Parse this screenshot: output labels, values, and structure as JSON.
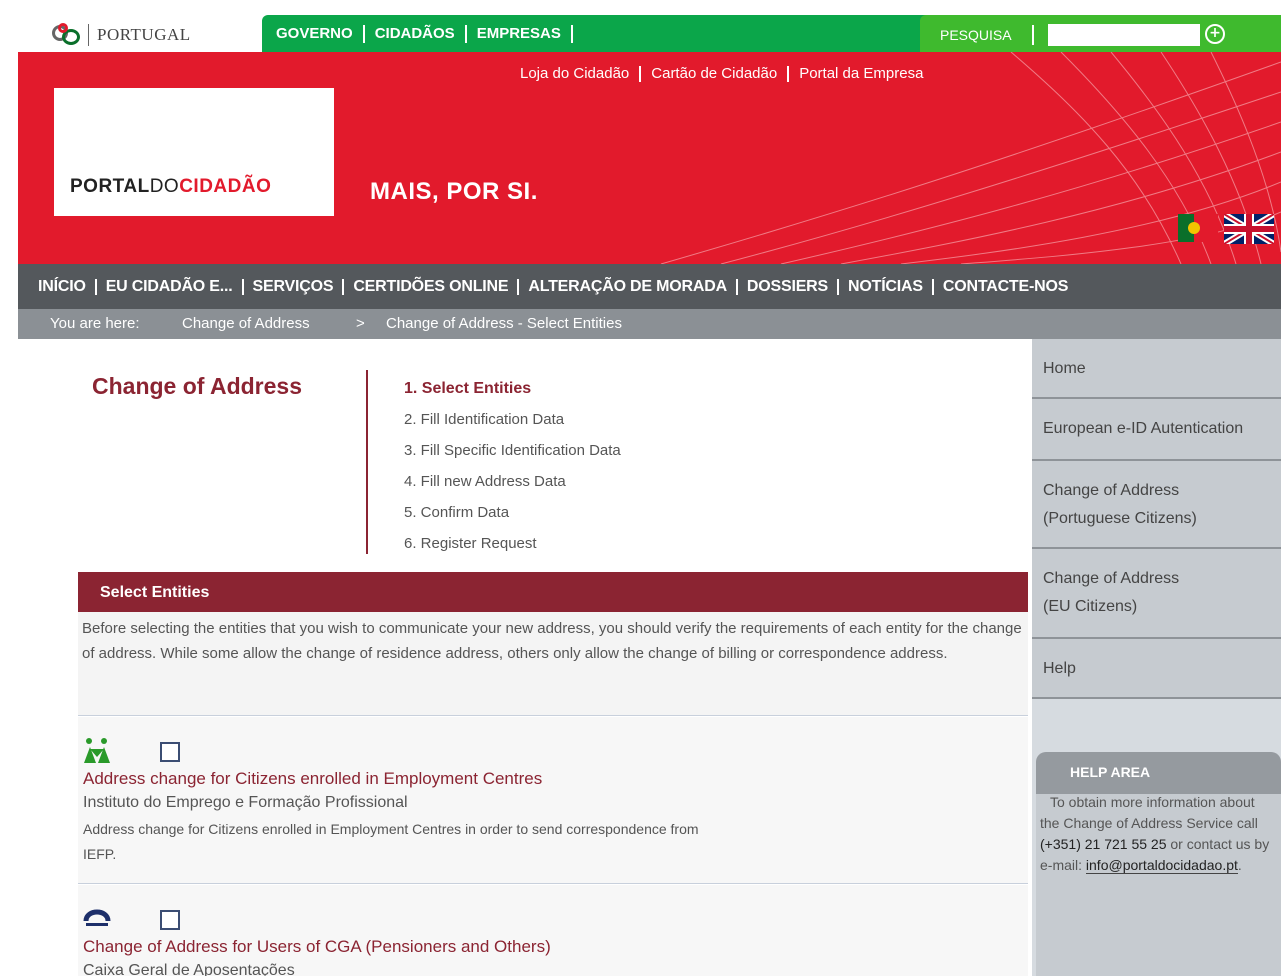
{
  "topbar": {
    "country": "PORTUGAL",
    "gov_links": [
      "GOVERNO",
      "CIDADÃOS",
      "EMPRESAS"
    ],
    "search_label": "PESQUISA",
    "search_value": ""
  },
  "banner": {
    "top_links": [
      "Loja do Cidadão",
      "Cartão de Cidadão",
      "Portal da Empresa"
    ],
    "logo": {
      "part1": "PORTAL",
      "part2": "DO",
      "part3": "CIDADÃO"
    },
    "slogan": "MAIS, POR SI."
  },
  "mainnav": {
    "items": [
      "INÍCIO",
      "EU CIDADÃO E...",
      "SERVIÇOS",
      "CERTIDÕES ONLINE",
      "ALTERAÇÃO DE MORADA",
      "DOSSIERS",
      "NOTÍCIAS",
      "CONTACTE-NOS"
    ]
  },
  "breadcrumb": {
    "label": "You are here:",
    "items": [
      "Change of Address",
      ">",
      "Change of Address - Select Entities"
    ]
  },
  "page": {
    "title": "Change of Address",
    "steps": [
      "1. Select Entities",
      "2. Fill Identification Data",
      "3. Fill Specific Identification Data",
      "4. Fill new Address Data",
      "5. Confirm Data",
      "6. Register Request"
    ]
  },
  "select": {
    "heading": "Select Entities",
    "intro": "Before selecting the entities that you wish to communicate your new address, you should verify the requirements of each entity for the change of address. While some allow the change of residence address, others only allow the change of billing or correspondence address."
  },
  "entities": [
    {
      "name": "Address change for Citizens enrolled in Employment Centres",
      "org": "Instituto do Emprego e Formação Profissional",
      "desc": "Address change for Citizens enrolled in Employment Centres in order to send correspondence from IEFP."
    },
    {
      "name": "Change of Address for Users of CGA (Pensioners and Others)",
      "org": "Caixa Geral de Aposentações",
      "desc": ""
    }
  ],
  "sidebar": {
    "items": [
      {
        "line1": "Home",
        "line2": ""
      },
      {
        "line1": "European e-ID Autentication",
        "line2": ""
      },
      {
        "line1": "Change of Address",
        "line2": "(Portuguese Citizens)"
      },
      {
        "line1": "Change of Address",
        "line2": "(EU Citizens)"
      },
      {
        "line1": "Help",
        "line2": ""
      }
    ]
  },
  "help": {
    "heading": "HELP AREA",
    "text1": "To obtain more information about the Change of Address Service call ",
    "phone": "(+351) 21 721 55 25",
    "text2": " or contact us by e-mail: ",
    "email": "info@portaldocidadao.pt",
    "text3": "."
  },
  "colors": {
    "brand_red": "#e21a2c",
    "gov_green": "#0ba64a",
    "accent_wine": "#8b2432",
    "nav_gray": "#54585c"
  }
}
